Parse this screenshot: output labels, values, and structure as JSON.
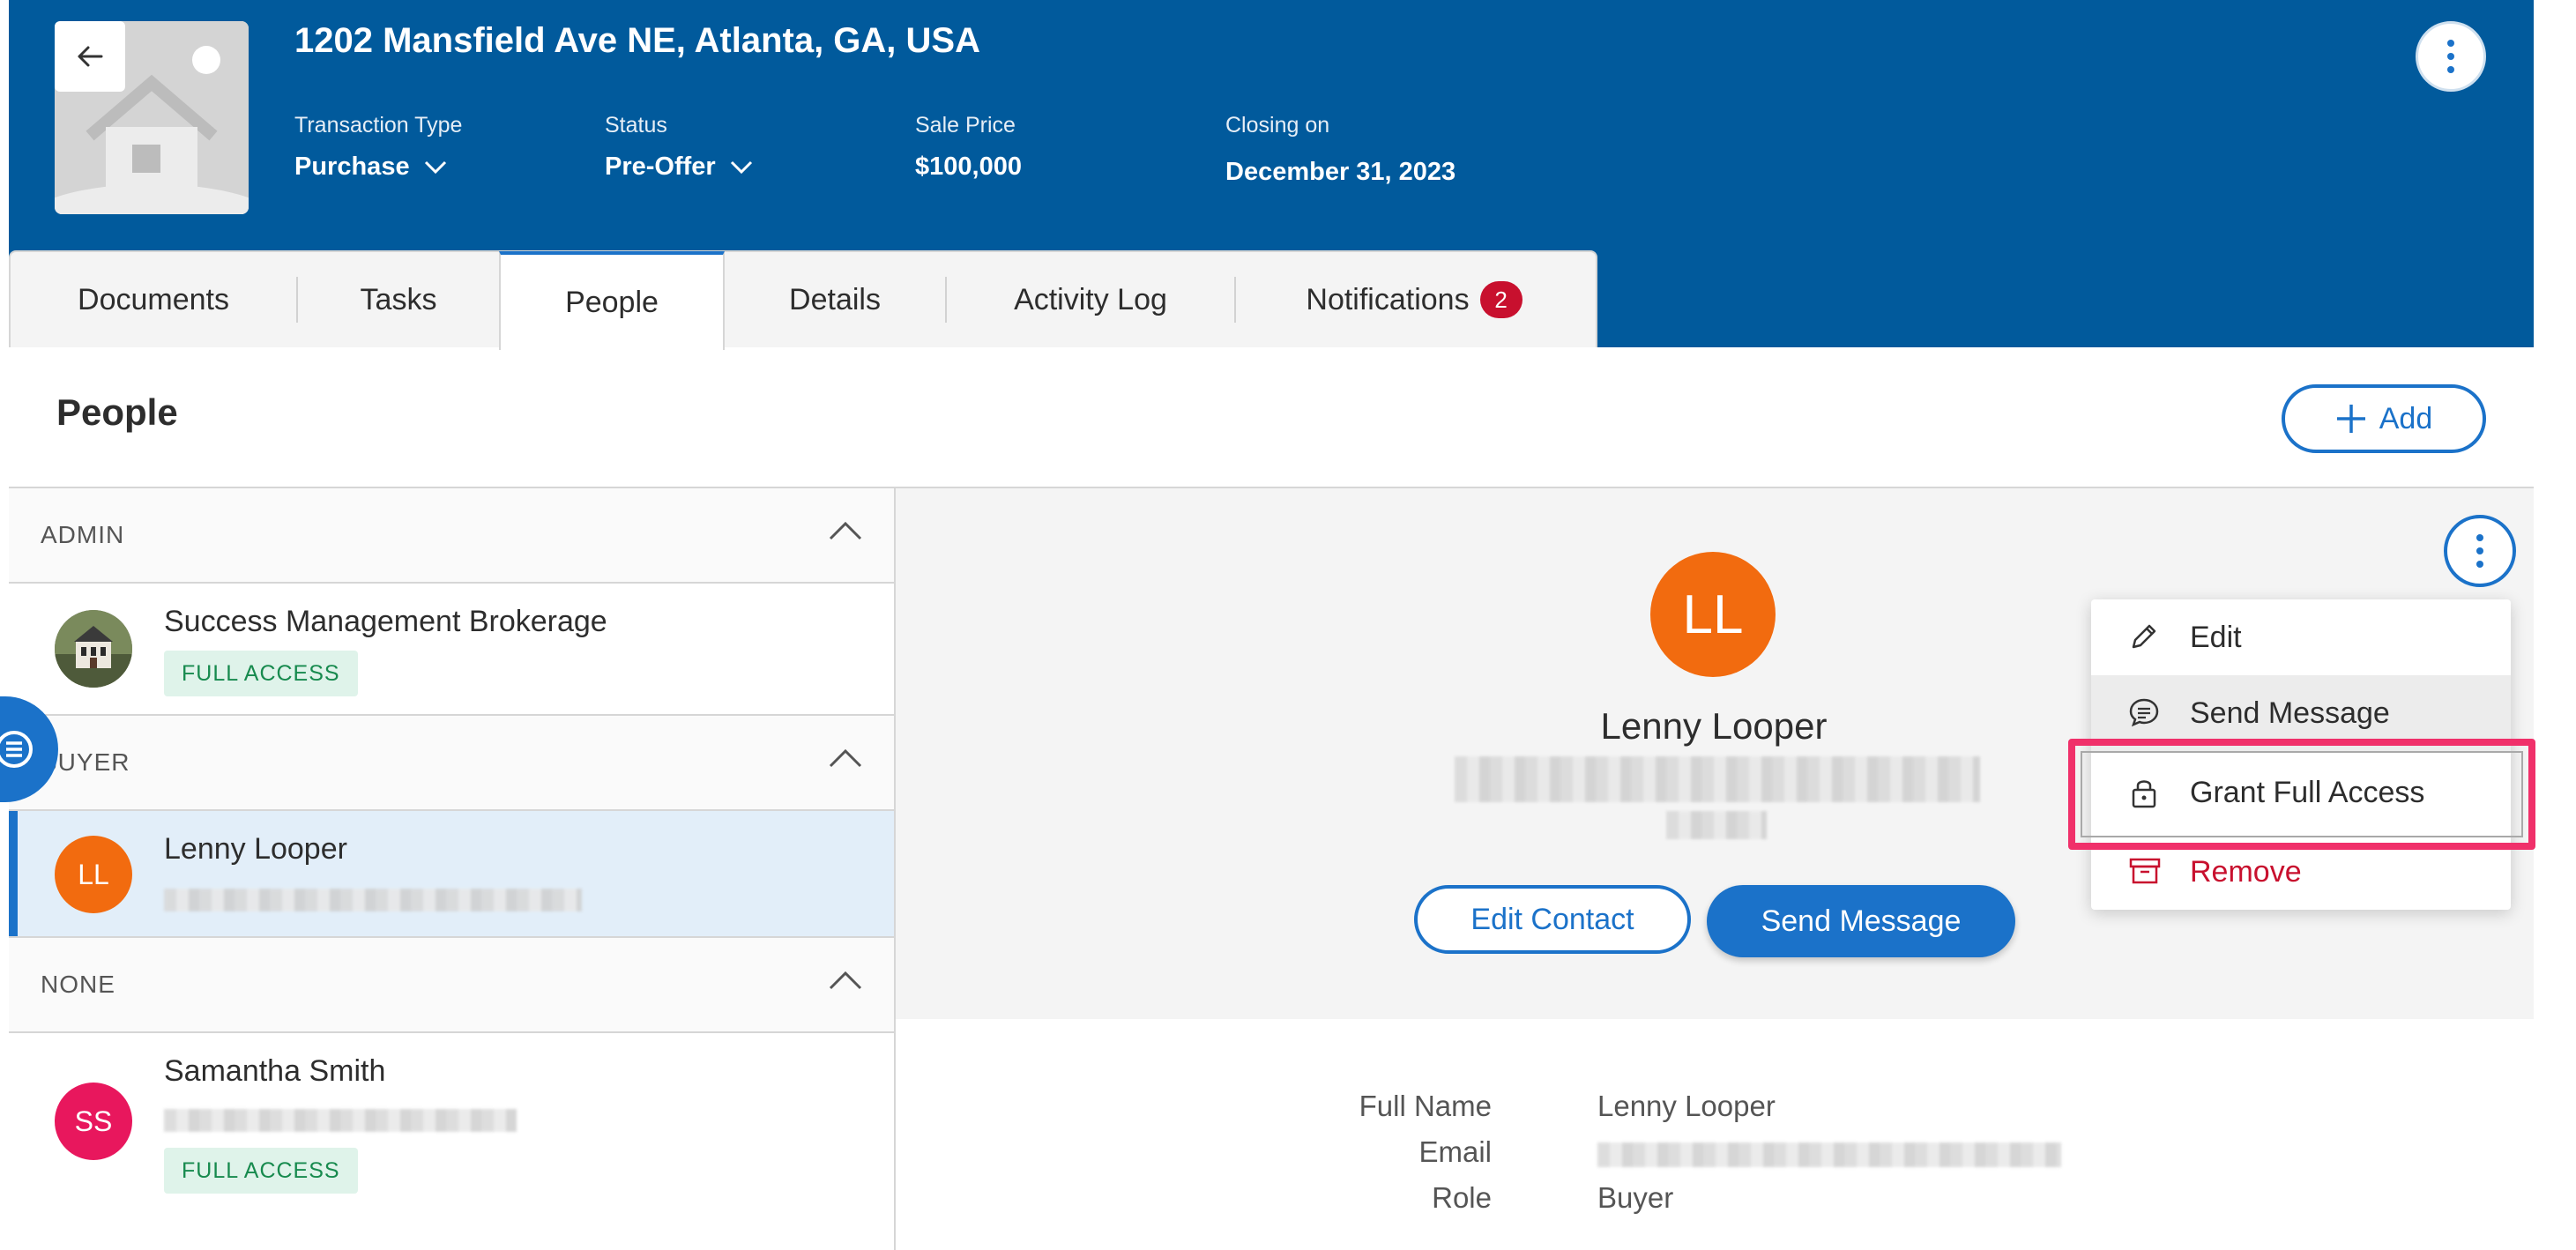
{
  "header": {
    "address": "1202 Mansfield Ave NE, Atlanta, GA, USA",
    "transaction_type": {
      "label": "Transaction Type",
      "value": "Purchase"
    },
    "status": {
      "label": "Status",
      "value": "Pre-Offer"
    },
    "sale_price": {
      "label": "Sale Price",
      "value": "$100,000"
    },
    "closing": {
      "label": "Closing on",
      "value": "December 31, 2023"
    }
  },
  "tabs": [
    {
      "label": "Documents"
    },
    {
      "label": "Tasks"
    },
    {
      "label": "People",
      "active": true
    },
    {
      "label": "Details"
    },
    {
      "label": "Activity Log"
    },
    {
      "label": "Notifications",
      "badge": "2"
    }
  ],
  "section": {
    "title": "People",
    "add_label": "Add"
  },
  "groups": [
    {
      "label": "ADMIN",
      "people": [
        {
          "initials": "",
          "name": "Success Management Brokerage",
          "access": "FULL ACCESS"
        }
      ]
    },
    {
      "label": "BUYER",
      "people": [
        {
          "initials": "LL",
          "name": "Lenny Looper",
          "access": ""
        }
      ]
    },
    {
      "label": "NONE",
      "people": [
        {
          "initials": "SS",
          "name": "Samantha Smith",
          "access": "FULL ACCESS"
        }
      ]
    }
  ],
  "detail": {
    "initials": "LL",
    "name": "Lenny Looper",
    "edit_contact": "Edit Contact",
    "send_message": "Send Message",
    "fields": [
      {
        "label": "Full Name",
        "value": "Lenny Looper"
      },
      {
        "label": "Email",
        "value": ""
      },
      {
        "label": "Role",
        "value": "Buyer"
      }
    ]
  },
  "menu": {
    "items": [
      {
        "label": "Edit",
        "icon": "pencil-icon"
      },
      {
        "label": "Send Message",
        "icon": "chat-icon"
      },
      {
        "label": "Grant Full Access",
        "icon": "lock-icon"
      },
      {
        "label": "Remove",
        "icon": "archive-icon"
      }
    ]
  },
  "colors": {
    "brand": "#015a9c",
    "accent": "#1b72c9",
    "danger": "#c8102e",
    "highlight": "#f0306a",
    "avatar_ll": "#f26b0f",
    "avatar_ss": "#e8175d"
  }
}
